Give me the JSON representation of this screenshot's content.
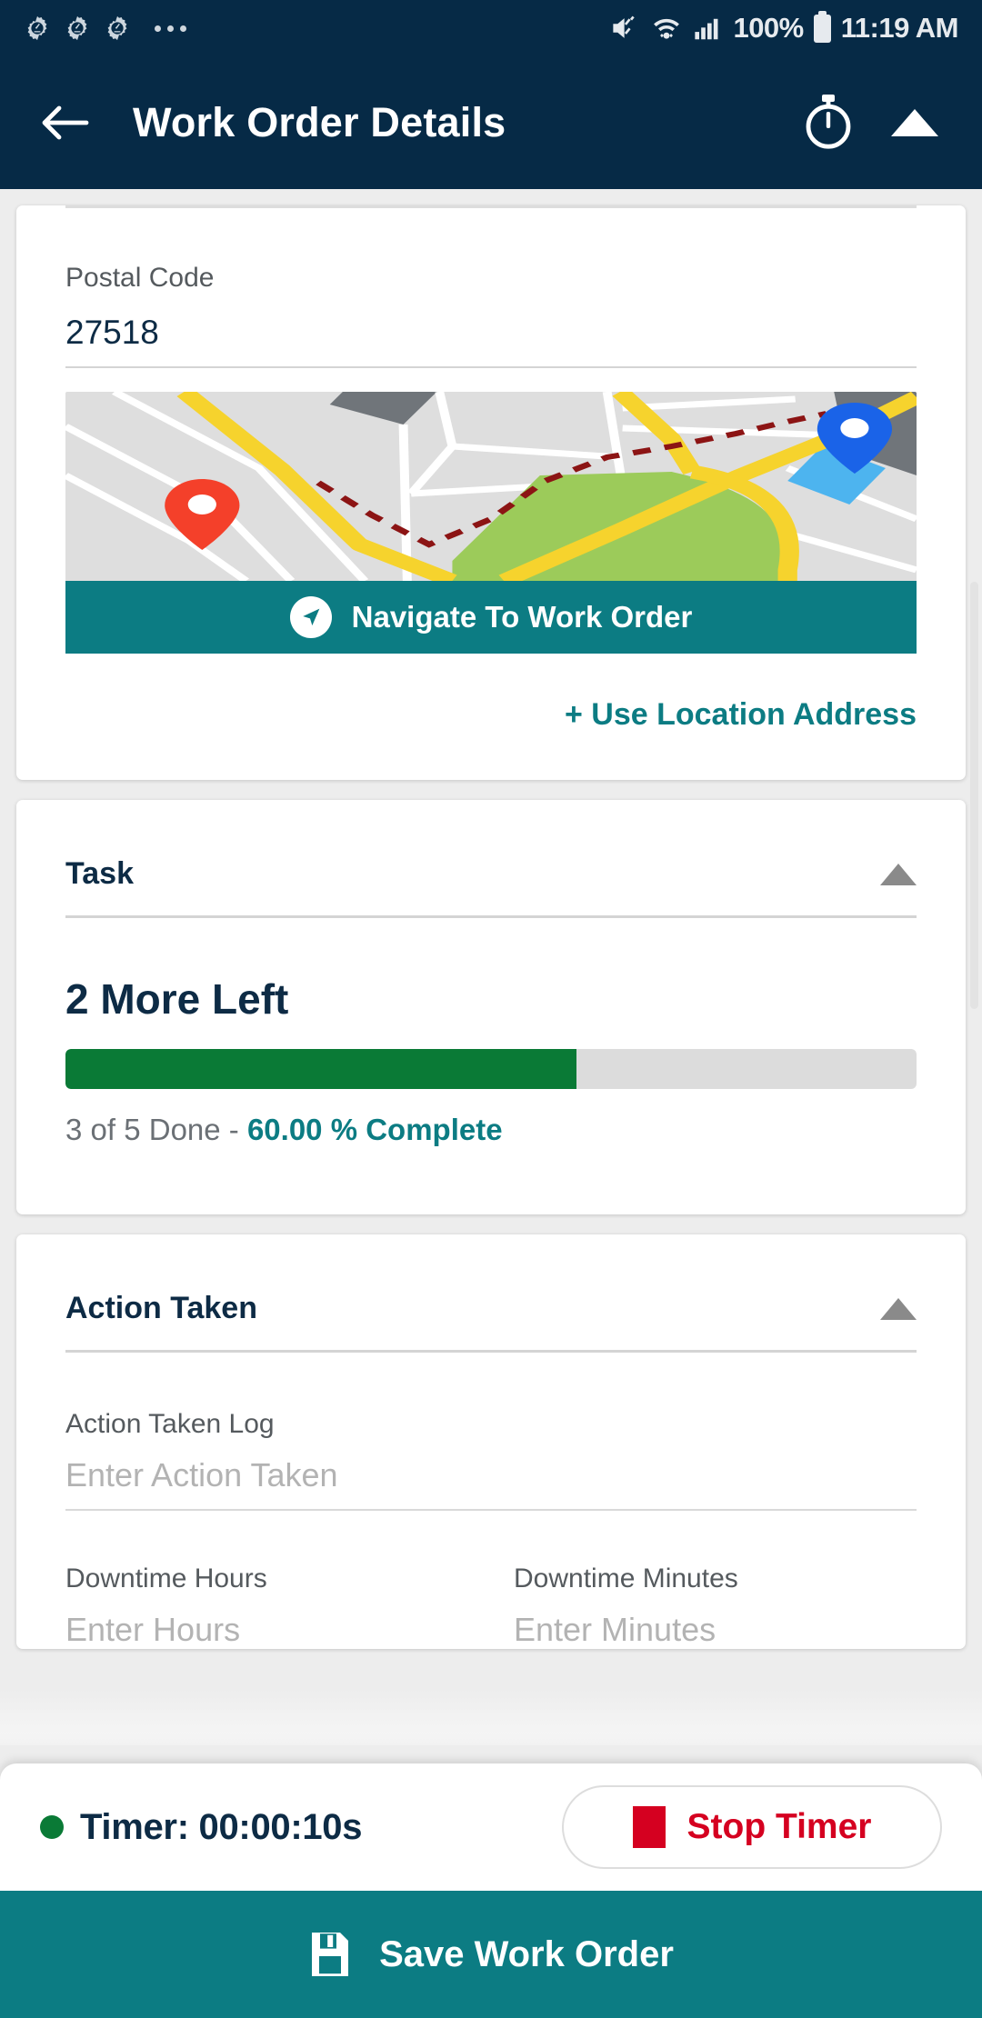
{
  "statusbar": {
    "icons": [
      "gear-icon",
      "gear-icon",
      "gear-icon",
      "more-dots-icon"
    ],
    "mute_icon": "volume-mute-icon",
    "wifi_icon": "wifi-icon",
    "signal_icon": "cellular-signal-icon",
    "battery_percent": "100%",
    "battery_icon": "battery-full-icon",
    "time": "11:19 AM"
  },
  "appbar": {
    "back_icon": "back-arrow-icon",
    "title": "Work Order Details",
    "timer_icon": "stopwatch-icon",
    "collapse_icon": "triangle-up-icon"
  },
  "location_card": {
    "postal_label": "Postal Code",
    "postal_value": "27518",
    "map_icon": "map-preview",
    "navigate_button": "Navigate To Work Order",
    "navigate_icon": "navigation-arrow-icon",
    "use_location_link": "+ Use Location Address"
  },
  "task_card": {
    "title": "Task",
    "collapse_icon": "triangle-up-icon",
    "headline": "2 More Left",
    "progress_percent": 60,
    "summary_prefix": "3 of 5 Done  -  ",
    "summary_percent": "60.00 % Complete"
  },
  "action_card": {
    "title": "Action Taken",
    "collapse_icon": "triangle-up-icon",
    "log_label": "Action Taken Log",
    "log_placeholder": "Enter Action Taken",
    "downtime_hours_label": "Downtime Hours",
    "downtime_hours_placeholder": "Enter Hours",
    "downtime_minutes_label": "Downtime Minutes",
    "downtime_minutes_placeholder": "Enter Minutes"
  },
  "timerbar": {
    "status_icon": "green-status-dot",
    "timer_text": "Timer: 00:00:10s",
    "stop_icon": "stop-square-icon",
    "stop_label": "Stop Timer"
  },
  "savebar": {
    "save_icon": "floppy-disk-save-icon",
    "save_label": "Save Work Order"
  },
  "colors": {
    "header": "#062a46",
    "teal": "#0c7c83",
    "green": "#0a7a36",
    "red": "#d50020",
    "navy_text": "#0d2b45"
  }
}
